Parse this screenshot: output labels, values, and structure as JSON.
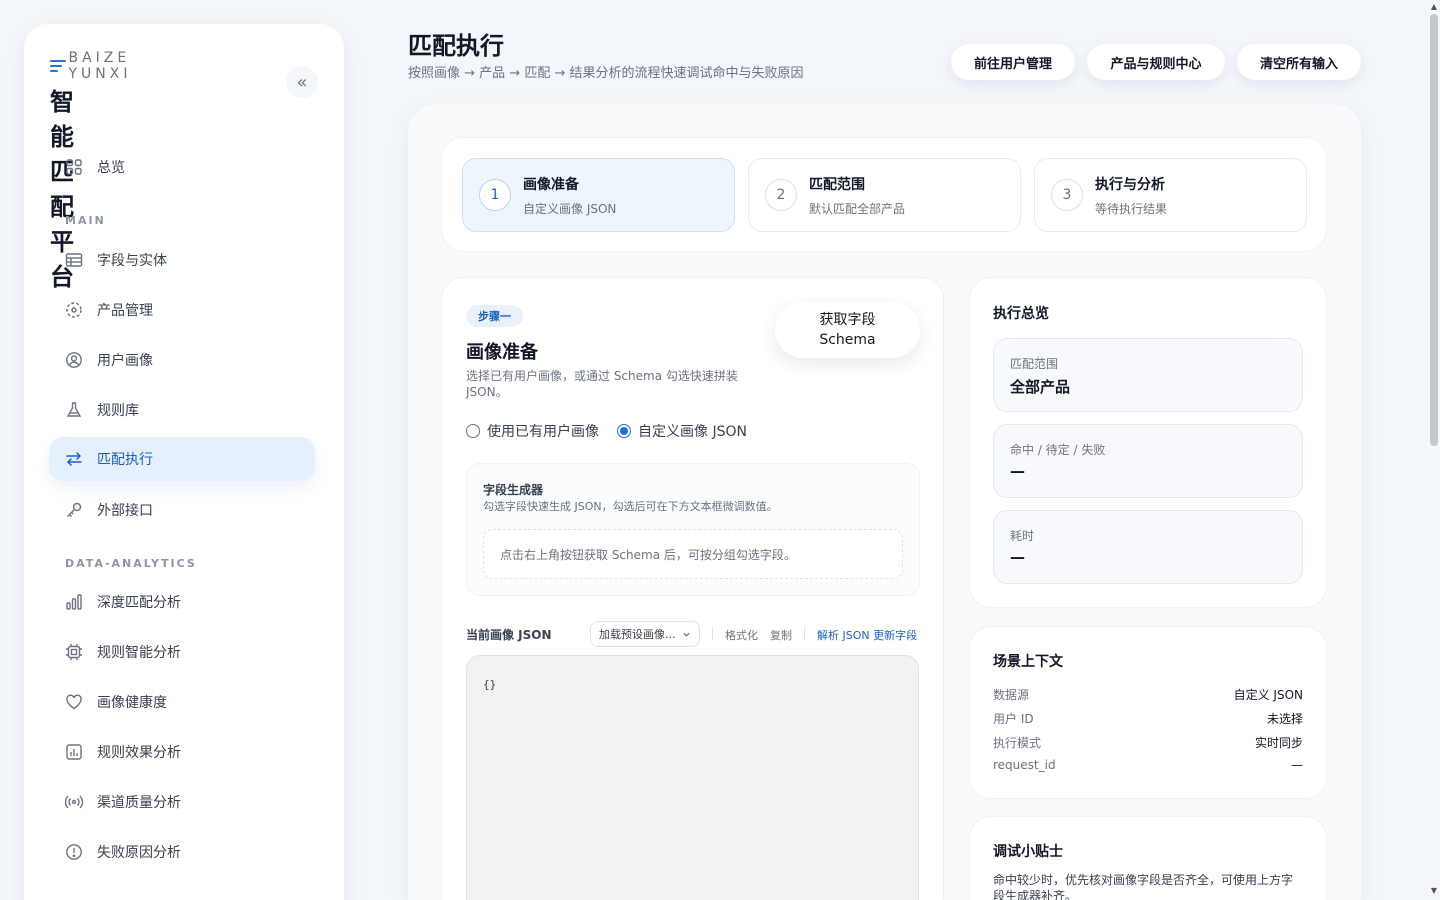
{
  "sidebar": {
    "brand_sub": "BAIZE YUNXI",
    "brand_title": "智能匹配平台",
    "collapse_glyph": "«",
    "overview": "总览",
    "section_main": "MAIN",
    "section_analytics": "DATA-ANALYTICS",
    "items": [
      {
        "label": "字段与实体",
        "icon": "table-icon"
      },
      {
        "label": "产品管理",
        "icon": "box-icon"
      },
      {
        "label": "用户画像",
        "icon": "user-circle-icon"
      },
      {
        "label": "规则库",
        "icon": "flask-icon"
      },
      {
        "label": "匹配执行",
        "icon": "swap-arrows-icon",
        "active": true
      },
      {
        "label": "外部接口",
        "icon": "key-icon"
      },
      {
        "label": "深度匹配分析",
        "icon": "bar-chart-icon"
      },
      {
        "label": "规则智能分析",
        "icon": "chip-icon"
      },
      {
        "label": "画像健康度",
        "icon": "heart-icon"
      },
      {
        "label": "规则效果分析",
        "icon": "chart-box-icon"
      },
      {
        "label": "渠道质量分析",
        "icon": "signal-icon"
      },
      {
        "label": "失败原因分析",
        "icon": "alert-circle-icon"
      }
    ]
  },
  "header": {
    "title": "匹配执行",
    "subtitle": "按照画像 → 产品 → 匹配 → 结果分析的流程快速调试命中与失败原因",
    "buttons": [
      "前往用户管理",
      "产品与规则中心",
      "清空所有输入"
    ]
  },
  "steps": [
    {
      "num": "1",
      "title": "画像准备",
      "desc": "自定义画像 JSON",
      "active": true
    },
    {
      "num": "2",
      "title": "匹配范围",
      "desc": "默认匹配全部产品"
    },
    {
      "num": "3",
      "title": "执行与分析",
      "desc": "等待执行结果"
    }
  ],
  "profile_panel": {
    "badge": "步骤一",
    "title": "画像准备",
    "desc": "选择已有用户画像，或通过 Schema 勾选快速拼装 JSON。",
    "schema_button": "获取字段 Schema",
    "radio_existing": "使用已有用户画像",
    "radio_custom": "自定义画像 JSON",
    "selected_mode": "custom",
    "generator_title": "字段生成器",
    "generator_desc": "勾选字段快速生成 JSON，勾选后可在下方文本框微调数值。",
    "generator_empty": "点击右上角按钮获取 Schema 后，可按分组勾选字段。",
    "json_label": "当前画像 JSON",
    "preset_placeholder": "加载预设画像...",
    "format_link": "格式化",
    "copy_link": "复制",
    "parse_link": "解析 JSON 更新字段",
    "json_value": "{}"
  },
  "overview": {
    "title": "执行总览",
    "metrics": [
      {
        "label": "匹配范围",
        "value": "全部产品"
      },
      {
        "label": "命中 / 待定 / 失败",
        "value": "—"
      },
      {
        "label": "耗时",
        "value": "—"
      }
    ]
  },
  "context": {
    "title": "场景上下文",
    "rows": [
      {
        "key": "数据源",
        "value": "自定义 JSON"
      },
      {
        "key": "用户 ID",
        "value": "未选择"
      },
      {
        "key": "执行模式",
        "value": "实时同步"
      },
      {
        "key": "request_id",
        "value": "—"
      }
    ]
  },
  "tips": {
    "title": "调试小贴士",
    "text": "命中较少时，优先核对画像字段是否齐全，可使用上方字段生成器补齐。"
  },
  "colors": {
    "accent": "#1d5fc4",
    "background": "#f3f6fa"
  }
}
